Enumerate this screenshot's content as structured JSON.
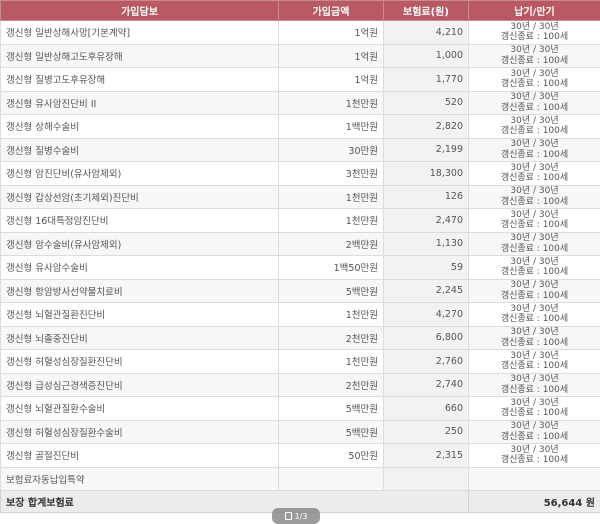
{
  "headers": {
    "coverage": "가입담보",
    "amount": "가입금액",
    "premium": "보험료(원)",
    "term": "납기/만기"
  },
  "rows": [
    {
      "coverage": "갱신형 일반상해사망[기본계약]",
      "amount": "1억원",
      "premium": "4,210",
      "term1": "30년 / 30년",
      "term2": "갱신종료 : 100세"
    },
    {
      "coverage": "갱신형 일반상해고도후유장해",
      "amount": "1억원",
      "premium": "1,000",
      "term1": "30년 / 30년",
      "term2": "갱신종료 : 100세"
    },
    {
      "coverage": "갱신형 질병고도후유장해",
      "amount": "1억원",
      "premium": "1,770",
      "term1": "30년 / 30년",
      "term2": "갱신종료 : 100세"
    },
    {
      "coverage": "갱신형 유사암진단비 II",
      "amount": "1천만원",
      "premium": "520",
      "term1": "30년 / 30년",
      "term2": "갱신종료 : 100세"
    },
    {
      "coverage": "갱신형 상해수술비",
      "amount": "1백만원",
      "premium": "2,820",
      "term1": "30년 / 30년",
      "term2": "갱신종료 : 100세"
    },
    {
      "coverage": "갱신형 질병수술비",
      "amount": "30만원",
      "premium": "2,199",
      "term1": "30년 / 30년",
      "term2": "갱신종료 : 100세"
    },
    {
      "coverage": "갱신형 암진단비(유사암제외)",
      "amount": "3천만원",
      "premium": "18,300",
      "term1": "30년 / 30년",
      "term2": "갱신종료 : 100세"
    },
    {
      "coverage": "갱신형 갑상선암(초기제외)진단비",
      "amount": "1천만원",
      "premium": "126",
      "term1": "30년 / 30년",
      "term2": "갱신종료 : 100세"
    },
    {
      "coverage": "갱신형 16대특정암진단비",
      "amount": "1천만원",
      "premium": "2,470",
      "term1": "30년 / 30년",
      "term2": "갱신종료 : 100세"
    },
    {
      "coverage": "갱신형 암수술비(유사암제외)",
      "amount": "2백만원",
      "premium": "1,130",
      "term1": "30년 / 30년",
      "term2": "갱신종료 : 100세"
    },
    {
      "coverage": "갱신형 유사암수술비",
      "amount": "1백50만원",
      "premium": "59",
      "term1": "30년 / 30년",
      "term2": "갱신종료 : 100세"
    },
    {
      "coverage": "갱신형 항암방사선약물치료비",
      "amount": "5백만원",
      "premium": "2,245",
      "term1": "30년 / 30년",
      "term2": "갱신종료 : 100세"
    },
    {
      "coverage": "갱신형 뇌혈관질환진단비",
      "amount": "1천만원",
      "premium": "4,270",
      "term1": "30년 / 30년",
      "term2": "갱신종료 : 100세"
    },
    {
      "coverage": "갱신형 뇌졸중진단비",
      "amount": "2천만원",
      "premium": "6,800",
      "term1": "30년 / 30년",
      "term2": "갱신종료 : 100세"
    },
    {
      "coverage": "갱신형 허혈성심장질환진단비",
      "amount": "1천만원",
      "premium": "2,760",
      "term1": "30년 / 30년",
      "term2": "갱신종료 : 100세"
    },
    {
      "coverage": "갱신형 급성심근경색증진단비",
      "amount": "2천만원",
      "premium": "2,740",
      "term1": "30년 / 30년",
      "term2": "갱신종료 : 100세"
    },
    {
      "coverage": "갱신형 뇌혈관질환수술비",
      "amount": "5백만원",
      "premium": "660",
      "term1": "30년 / 30년",
      "term2": "갱신종료 : 100세"
    },
    {
      "coverage": "갱신형 허혈성심장질환수술비",
      "amount": "5백만원",
      "premium": "250",
      "term1": "30년 / 30년",
      "term2": "갱신종료 : 100세"
    },
    {
      "coverage": "갱신형 골절진단비",
      "amount": "50만원",
      "premium": "2,315",
      "term1": "30년 / 30년",
      "term2": "갱신종료 : 100세"
    },
    {
      "coverage": "보험료자동납입특약",
      "amount": "",
      "premium": "",
      "term1": "",
      "term2": ""
    }
  ],
  "footer": {
    "label": "보장 합계보험료",
    "total": "56,644 원"
  },
  "pager": {
    "icon": "document-icon",
    "text": "1/3"
  }
}
